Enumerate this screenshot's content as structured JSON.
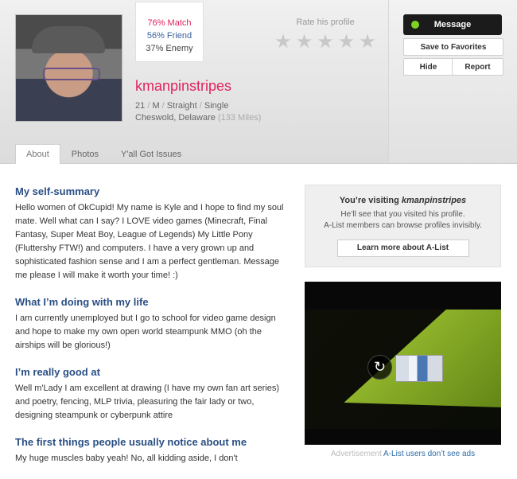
{
  "profile": {
    "match": "76% Match",
    "friend": "56% Friend",
    "enemy": "37% Enemy",
    "username": "kmanpinstripes",
    "stats": [
      "21",
      "M",
      "Straight",
      "Single"
    ],
    "location": "Cheswold, Delaware",
    "distance": "(133 Miles)"
  },
  "rating": {
    "label": "Rate his profile",
    "stars": 5
  },
  "actions": {
    "message": "Message",
    "save": "Save to Favorites",
    "hide": "Hide",
    "report": "Report"
  },
  "tabs": [
    "About",
    "Photos",
    "Y'all Got Issues"
  ],
  "sections": [
    {
      "heading": "My self-summary",
      "text": "Hello women of OkCupid! My name is Kyle and I hope to find my soul mate. Well what can I say? I LOVE video games (Minecraft, Final Fantasy, Super Meat Boy, League of Legends) My Little Pony (Fluttershy FTW!) and computers. I have a very grown up and sophisticated fashion sense and I am a perfect gentleman. Message me please I will make it worth your time! :)"
    },
    {
      "heading": "What I’m doing with my life",
      "text": "I am currently unemployed but I go to school for video game design and hope to make my own open world steampunk MMO (oh the airships will be glorious!)"
    },
    {
      "heading": "I’m really good at",
      "text": "Well m'Lady I am excellent at drawing (I have my own fan art series) and poetry, fencing, MLP trivia, pleasuring the fair lady or two, designing steampunk or cyberpunk attire"
    },
    {
      "heading": "The first things people usually notice about me",
      "text": "My huge muscles baby yeah! No, all kidding aside, I don't"
    }
  ],
  "visit": {
    "title_prefix": "You’re visiting ",
    "title_name": "kmanpinstripes",
    "line1": "He’ll see that you visited his profile.",
    "line2": "A-List members can browse profiles invisibly.",
    "button": "Learn more about A-List"
  },
  "ad": {
    "label": "Advertisement",
    "note": "A-List users don’t see ads"
  },
  "colors": {
    "accent_pink": "#e0245e",
    "heading_blue": "#2a4f84",
    "online_green": "#7ed321"
  },
  "icons": [
    "star-icon",
    "replay-icon"
  ]
}
